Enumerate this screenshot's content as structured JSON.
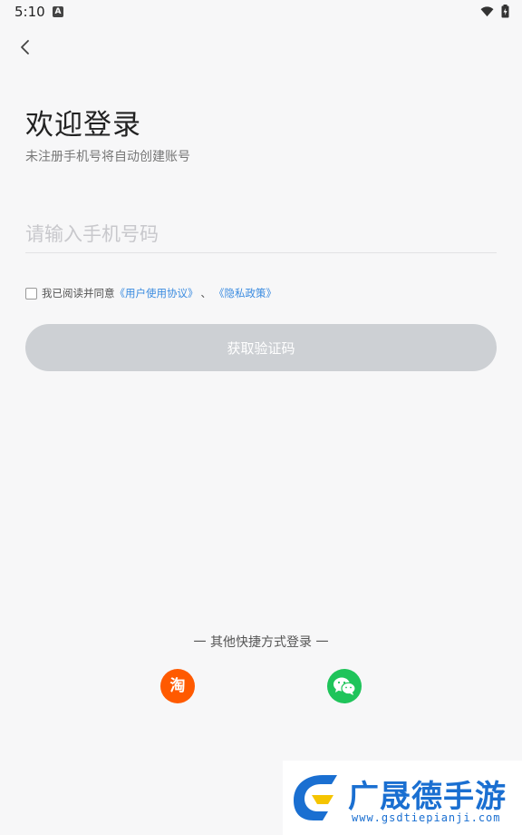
{
  "status_bar": {
    "time": "5:10",
    "notification_icon": "A"
  },
  "header": {
    "back_icon": "chevron-left-icon"
  },
  "main": {
    "title": "欢迎登录",
    "subtitle": "未注册手机号将自动创建账号",
    "phone_input": {
      "placeholder": "请输入手机号码",
      "value": ""
    },
    "agreement": {
      "checked": false,
      "prefix": "我已阅读并同意",
      "user_agreement": "《用户使用协议》",
      "separator": "、",
      "privacy_policy": "《隐私政策》"
    },
    "get_code_button": "获取验证码"
  },
  "other_login": {
    "label": "一 其他快捷方式登录 一",
    "taobao_label": "淘",
    "wechat_icon": "wechat-icon"
  },
  "watermark": {
    "name": "广晟德手游",
    "url": "www.gsdtiepianji.com"
  },
  "colors": {
    "background": "#f7f7f8",
    "link": "#3a8be0",
    "button_disabled": "#cdd0d4",
    "taobao": "#ff5a00",
    "wechat": "#1fc45a"
  }
}
